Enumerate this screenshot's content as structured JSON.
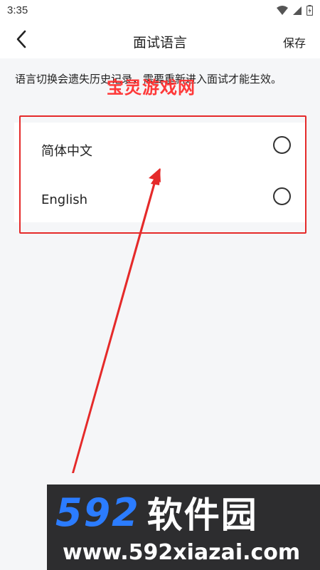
{
  "status_bar": {
    "time": "3:35",
    "icons": [
      "wifi-icon",
      "signal-icon",
      "battery-icon"
    ]
  },
  "header": {
    "title": "面试语言",
    "save_label": "保存",
    "back_icon": "chevron-left-icon"
  },
  "notice": "语言切换会遗失历史记录，需要重新进入面试才能生效。",
  "languages": [
    {
      "label": "简体中文",
      "selected": false
    },
    {
      "label": "English",
      "selected": false
    }
  ],
  "watermark_top": "宝灵游戏网",
  "banner": {
    "digits": "592",
    "cn": "软件园",
    "url": "www.592xiazai.com"
  },
  "colors": {
    "annotation_red": "#e52a2a",
    "banner_blue": "#2b7cff",
    "banner_bg": "#2d2d2f"
  }
}
